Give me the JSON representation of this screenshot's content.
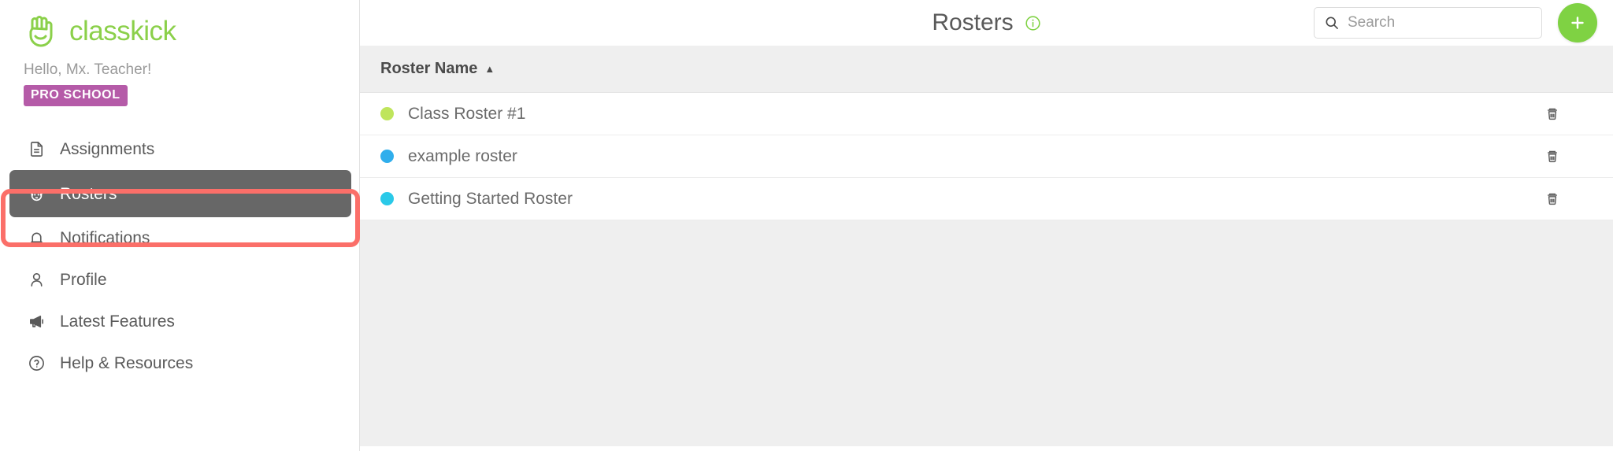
{
  "brand": {
    "name": "classkick",
    "logo_icon": "hand-logo-icon",
    "color": "#8BD04A"
  },
  "sidebar": {
    "greeting": "Hello, Mx. Teacher!",
    "plan_badge": "PRO SCHOOL",
    "plan_badge_color": "#B55BA8",
    "items": [
      {
        "label": "Assignments",
        "icon": "document-icon",
        "active": false
      },
      {
        "label": "Rosters",
        "icon": "roster-face-icon",
        "active": true
      },
      {
        "label": "Notifications",
        "icon": "bell-icon",
        "active": false
      },
      {
        "label": "Profile",
        "icon": "person-icon",
        "active": false
      },
      {
        "label": "Latest Features",
        "icon": "megaphone-icon",
        "active": false
      },
      {
        "label": "Help & Resources",
        "icon": "question-circle-icon",
        "active": false
      }
    ],
    "active_highlight_color": "#676767"
  },
  "header": {
    "title": "Rosters",
    "info_icon": "info-circle-icon",
    "info_icon_color": "#7FD243"
  },
  "search": {
    "placeholder": "Search",
    "value": "",
    "icon": "search-icon"
  },
  "add_button": {
    "label": "+",
    "icon": "plus-icon",
    "color": "#7FD243"
  },
  "annotations": {
    "highlight_color": "#FB6F69",
    "box_target": "sidebar-item-rosters",
    "arrow_target": "add-roster-button"
  },
  "table": {
    "columns": [
      {
        "label": "Roster Name",
        "sort": "asc",
        "sort_caret": "▲"
      }
    ],
    "rows": [
      {
        "name": "Class Roster #1",
        "dot_color": "#BFE55C",
        "delete_icon": "trash-icon"
      },
      {
        "name": "example roster",
        "dot_color": "#30AEEC",
        "delete_icon": "trash-icon"
      },
      {
        "name": "Getting Started Roster",
        "dot_color": "#2AC9E8",
        "delete_icon": "trash-icon"
      }
    ]
  }
}
